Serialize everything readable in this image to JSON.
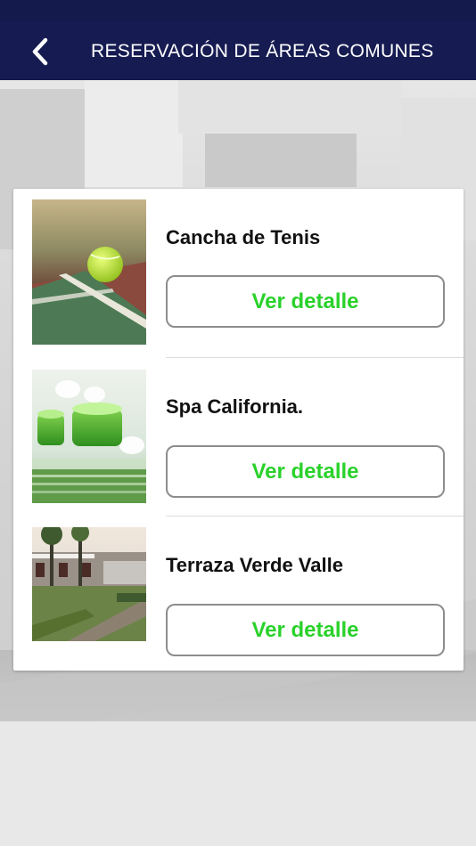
{
  "header": {
    "title": "RESERVACIÓN DE ÁREAS COMUNES",
    "back_icon": "chevron-left-icon"
  },
  "colors": {
    "nav_background": "#161c52",
    "button_text": "#2ad12a",
    "button_border": "#8d8d8d"
  },
  "areas": [
    {
      "name": "Cancha de Tenis",
      "button_label": "Ver detalle",
      "image": "tennis-court-photo"
    },
    {
      "name": "Spa California.",
      "button_label": "Ver detalle",
      "image": "spa-candles-photo"
    },
    {
      "name": "Terraza Verde Valle",
      "button_label": "Ver detalle",
      "image": "garden-terrace-photo"
    }
  ]
}
